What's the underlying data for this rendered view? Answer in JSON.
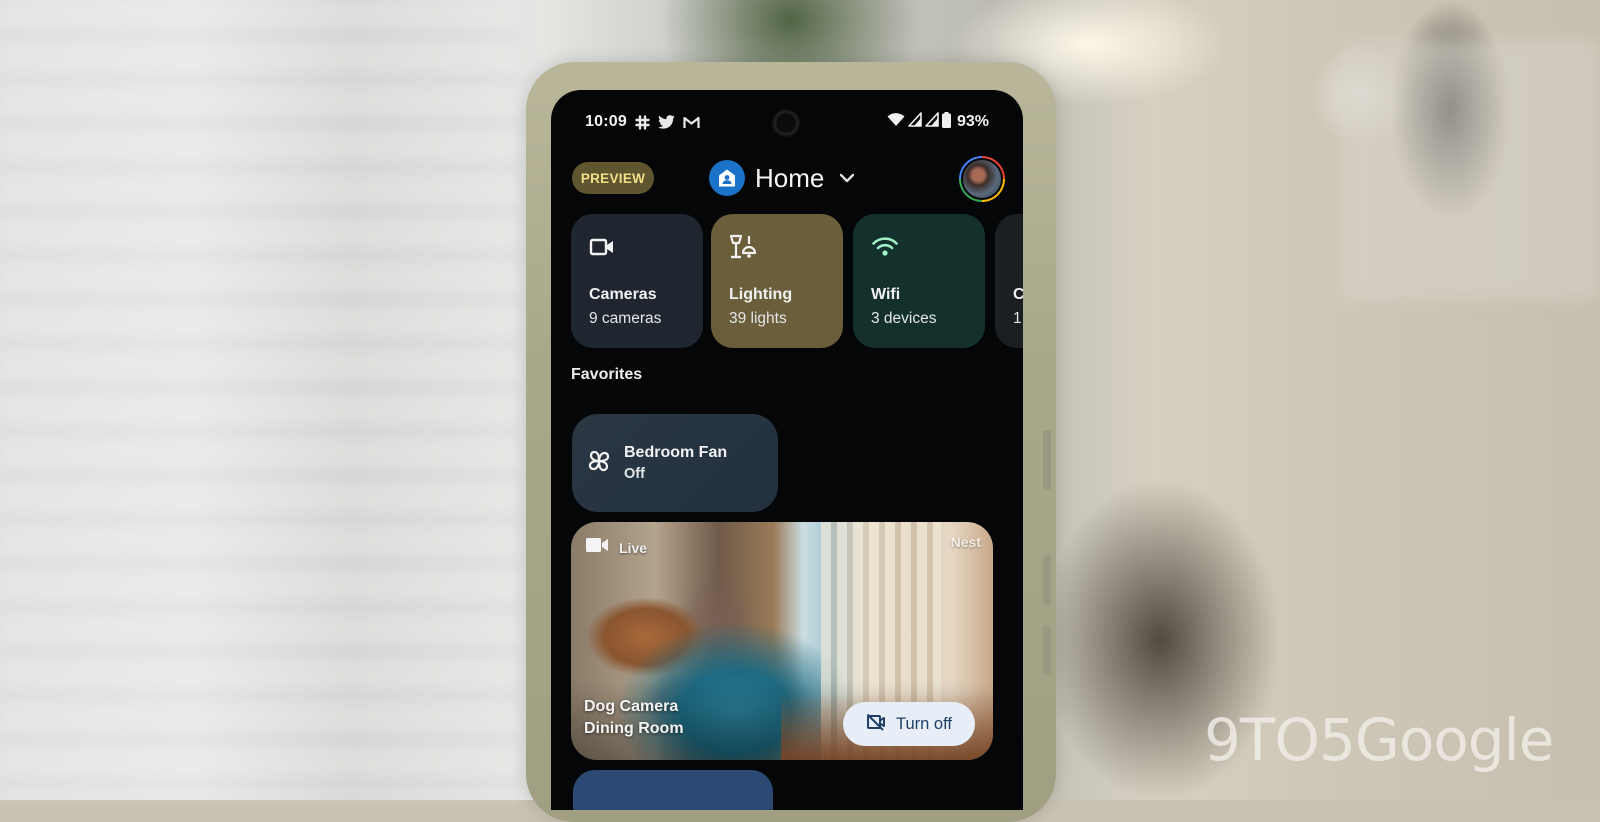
{
  "status_bar": {
    "time": "10:09",
    "notification_icons": [
      "slack-icon",
      "twitter-icon",
      "gmail-icon"
    ],
    "system_icons": [
      "wifi-icon",
      "signal-icon",
      "signal-icon",
      "battery-icon"
    ],
    "battery_percent": "93%"
  },
  "header": {
    "preview_badge": "PREVIEW",
    "home_name": "Home",
    "home_icon": "home-icon",
    "dropdown_icon": "chevron-down-icon",
    "avatar_icon": "account-avatar"
  },
  "categories": [
    {
      "name": "Cameras",
      "subtitle": "9 cameras",
      "icon": "videocam-icon",
      "color": "#1f262f"
    },
    {
      "name": "Lighting",
      "subtitle": "39 lights",
      "icon": "lamp-icon",
      "color": "#6a5f3a"
    },
    {
      "name": "Wifi",
      "subtitle": "3 devices",
      "icon": "wifi-icon",
      "color": "#14302d"
    },
    {
      "name": "C",
      "subtitle": "1",
      "icon": "",
      "color": "#1c1f22"
    }
  ],
  "favorites": {
    "title": "Favorites",
    "device": {
      "name": "Bedroom Fan",
      "state": "Off",
      "icon": "fan-icon"
    },
    "camera": {
      "live_label": "Live",
      "brand": "Nest",
      "name": "Dog Camera",
      "room": "Dining Room",
      "turn_off_label": "Turn off",
      "turn_off_icon": "videocam-off-icon"
    }
  },
  "watermark": "9TO5Google",
  "colors": {
    "preview_badge_bg": "#5f5630",
    "preview_badge_text": "#f0df86",
    "home_logo": "#1a72c9",
    "turn_off_bg": "#e7eef7",
    "turn_off_text": "#1f3f66"
  }
}
